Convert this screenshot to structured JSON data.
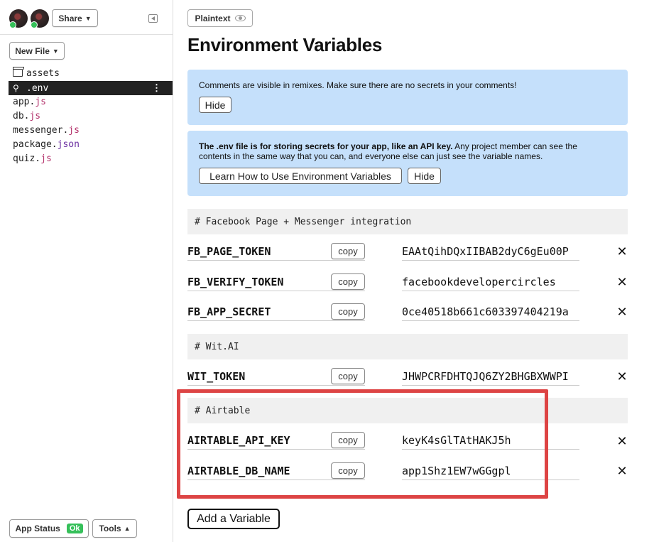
{
  "sidebar": {
    "share_label": "Share",
    "new_file_label": "New File",
    "files": [
      {
        "name": "assets",
        "ext": "",
        "icon": "folder-icon"
      },
      {
        "name": ".env",
        "ext": "",
        "icon": "key-icon",
        "active": true
      },
      {
        "name": "app.",
        "ext": "js"
      },
      {
        "name": "db.",
        "ext": "js"
      },
      {
        "name": "messenger.",
        "ext": "js"
      },
      {
        "name": "package.",
        "ext": "json"
      },
      {
        "name": "quiz.",
        "ext": "js"
      }
    ],
    "kebab": "⋮",
    "app_status_label": "App Status",
    "app_status_value": "Ok",
    "tools_label": "Tools"
  },
  "main": {
    "plaintext_label": "Plaintext",
    "title": "Environment Variables",
    "notice1": {
      "text": "Comments are visible in remixes. Make sure there are no secrets in your comments!",
      "hide_label": "Hide"
    },
    "notice2": {
      "text_bold": "The .env file is for storing secrets for your app, like an API key.",
      "text_rest": " Any project member can see the contents in the same way that you can, and everyone else can just see the variable names.",
      "learn_label": "Learn How to Use Environment Variables",
      "hide_label": "Hide"
    },
    "comments": [
      "# Facebook Page + Messenger integration",
      "# Wit.AI",
      "# Airtable"
    ],
    "copy_label": "copy",
    "delete_glyph": "✕",
    "variables": [
      {
        "name": "FB_PAGE_TOKEN",
        "value": "EAAtQihDQxIIBAB2dyC6gEu00P"
      },
      {
        "name": "FB_VERIFY_TOKEN",
        "value": "facebookdevelopercircles"
      },
      {
        "name": "FB_APP_SECRET",
        "value": "0ce40518b661c603397404219a"
      },
      {
        "name": "WIT_TOKEN",
        "value": "JHWPCRFDHTQJQ6ZY2BHGBXWWPI"
      },
      {
        "name": "AIRTABLE_API_KEY",
        "value": "keyK4sGlTAtHAKJ5h"
      },
      {
        "name": "AIRTABLE_DB_NAME",
        "value": "app1Shz1EW7wGGgpl"
      }
    ],
    "add_variable_label": "Add a Variable"
  },
  "colors": {
    "notice_bg": "#c5e0fb",
    "status_ok": "#36c05a",
    "highlight": "#dd4444",
    "js_ext": "#b3326b",
    "json_ext": "#6a2ea0"
  }
}
